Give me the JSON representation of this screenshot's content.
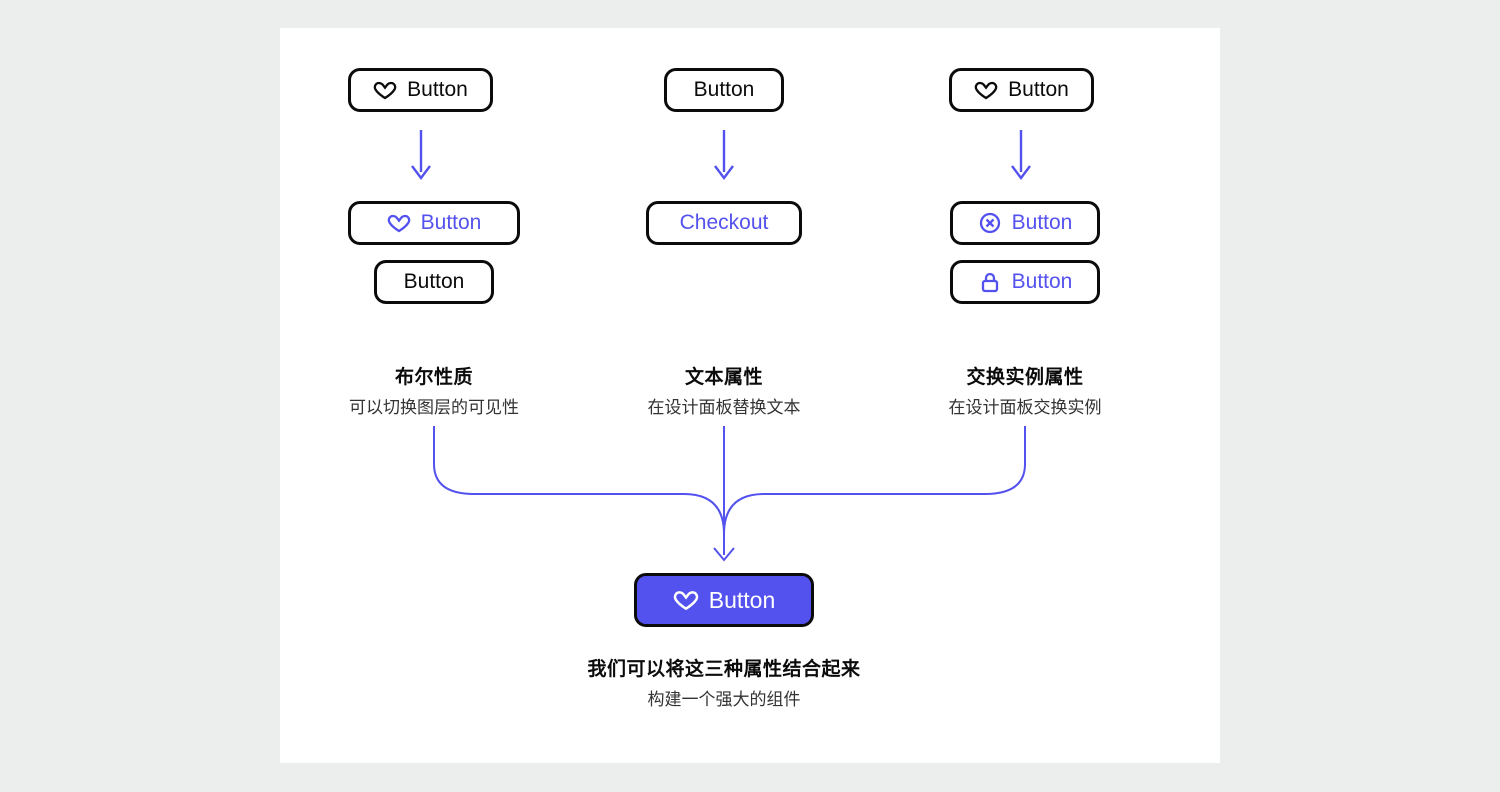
{
  "colors": {
    "accent": "#5452ee",
    "ink": "#0b0b0c"
  },
  "columns": {
    "boolean": {
      "title": "布尔性质",
      "desc": "可以切换图层的可见性"
    },
    "text": {
      "title": "文本属性",
      "desc": "在设计面板替换文本"
    },
    "instance": {
      "title": "交换实例属性",
      "desc": "在设计面板交换实例"
    }
  },
  "buttons": {
    "boolean": {
      "top": "Button",
      "mid": "Button",
      "bottom": "Button"
    },
    "text": {
      "top": "Button",
      "mid": "Checkout"
    },
    "instance": {
      "top": "Button",
      "mid": "Button",
      "bottom": "Button"
    }
  },
  "result": {
    "button_label": "Button",
    "title": "我们可以将这三种属性结合起来",
    "desc": "构建一个强大的组件"
  }
}
